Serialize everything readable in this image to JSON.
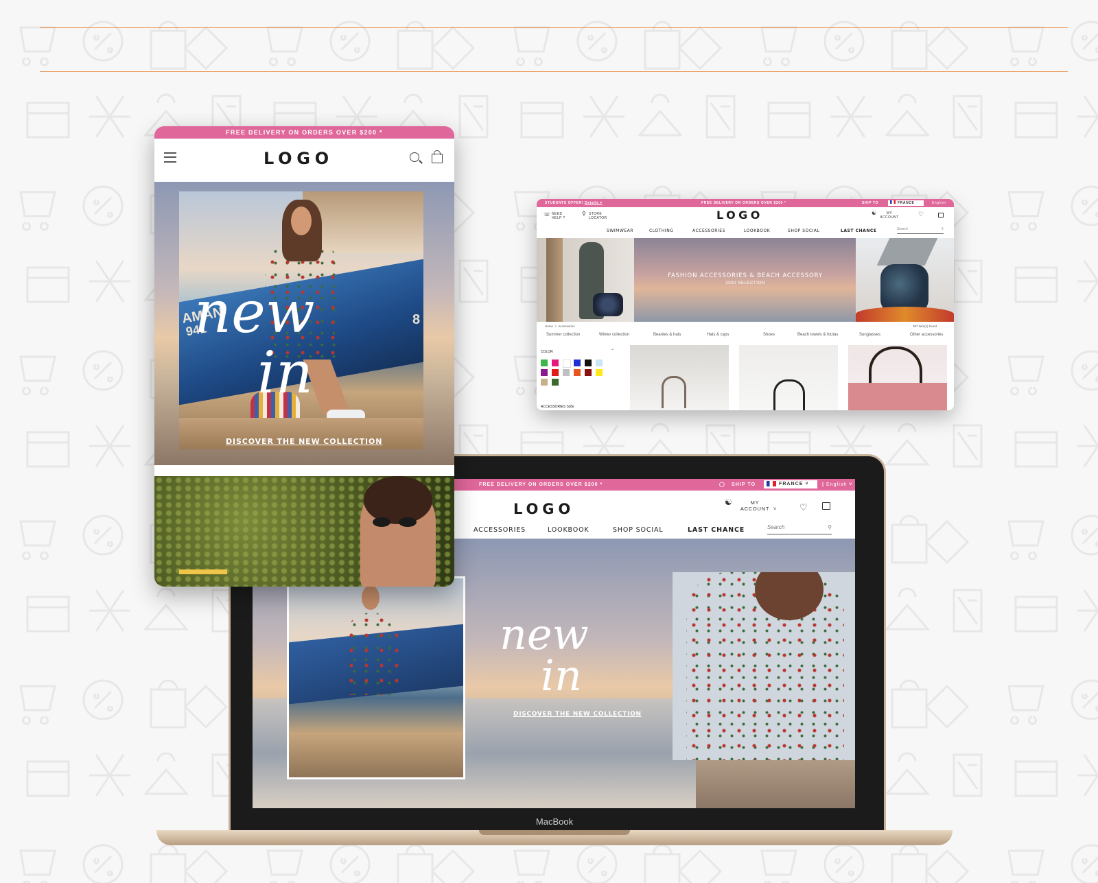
{
  "tablet": {
    "promo": "FREE DELIVERY ON ORDERS OVER $200 *",
    "logo": "LOGO",
    "hero_script_1": "new",
    "hero_script_2": "in",
    "hero_cta": "DISCOVER THE NEW COLLECTION",
    "boat_text_1": "AMAN",
    "boat_text_2": "941",
    "boat_text_3": "8"
  },
  "desktop": {
    "student_offer": "STUDENTS OFFER!",
    "student_link": "Details ▾",
    "promo": "FREE DELIVERY ON ORDERS OVER $200 *",
    "ship_to": "SHIP TO",
    "country": "FRANCE",
    "language": "English",
    "need_help": "NEED HELP ?",
    "store_locator": "STORE LOCATOR",
    "logo": "LOGO",
    "my_account": "MY ACCOUNT",
    "nav": [
      "SWIMWEAR",
      "CLOTHING",
      "ACCESSORIES",
      "LOOKBOOK",
      "SHOP SOCIAL",
      "LAST CHANCE"
    ],
    "search_placeholder": "Search",
    "banner_title": "FASHION ACCESSORIES & BEACH ACCESSORY",
    "banner_subtitle": "2020 SELECTION",
    "breadcrumb": [
      "Home",
      "Accessories"
    ],
    "items_found": "397 item(s) found",
    "subcategories": [
      "Summer collection",
      "Winter collection",
      "Beanies & hats",
      "Hats & caps",
      "Shoes",
      "Beach towels & foutas",
      "Sunglasses",
      "Other accessories"
    ],
    "filter_color_label": "COLOR",
    "filter_size_label": "ACCESSORIES SIZE",
    "colors": [
      "#3cb54a",
      "#e8197e",
      "#ffffff",
      "#1f2fd6",
      "#111111",
      "#c8e6f5",
      "#8b1a8f",
      "#e21b1b",
      "#c0c0c0",
      "#e8561e",
      "#8b1010",
      "#ffe81a",
      "#c8b08a",
      "#3a6b2a"
    ]
  },
  "laptop": {
    "promo": "FREE DELIVERY ON ORDERS OVER $200 *",
    "ship_to": "SHIP TO",
    "country": "FRANCE",
    "language": "English",
    "logo": "LOGO",
    "my_account": "MY ACCOUNT",
    "nav": [
      "ACCESSORIES",
      "LOOKBOOK",
      "SHOP SOCIAL",
      "LAST CHANCE"
    ],
    "search_placeholder": "Search",
    "hero_script_1": "new",
    "hero_script_2": "in",
    "hero_cta": "DISCOVER THE NEW COLLECTION",
    "brand": "MacBook"
  }
}
